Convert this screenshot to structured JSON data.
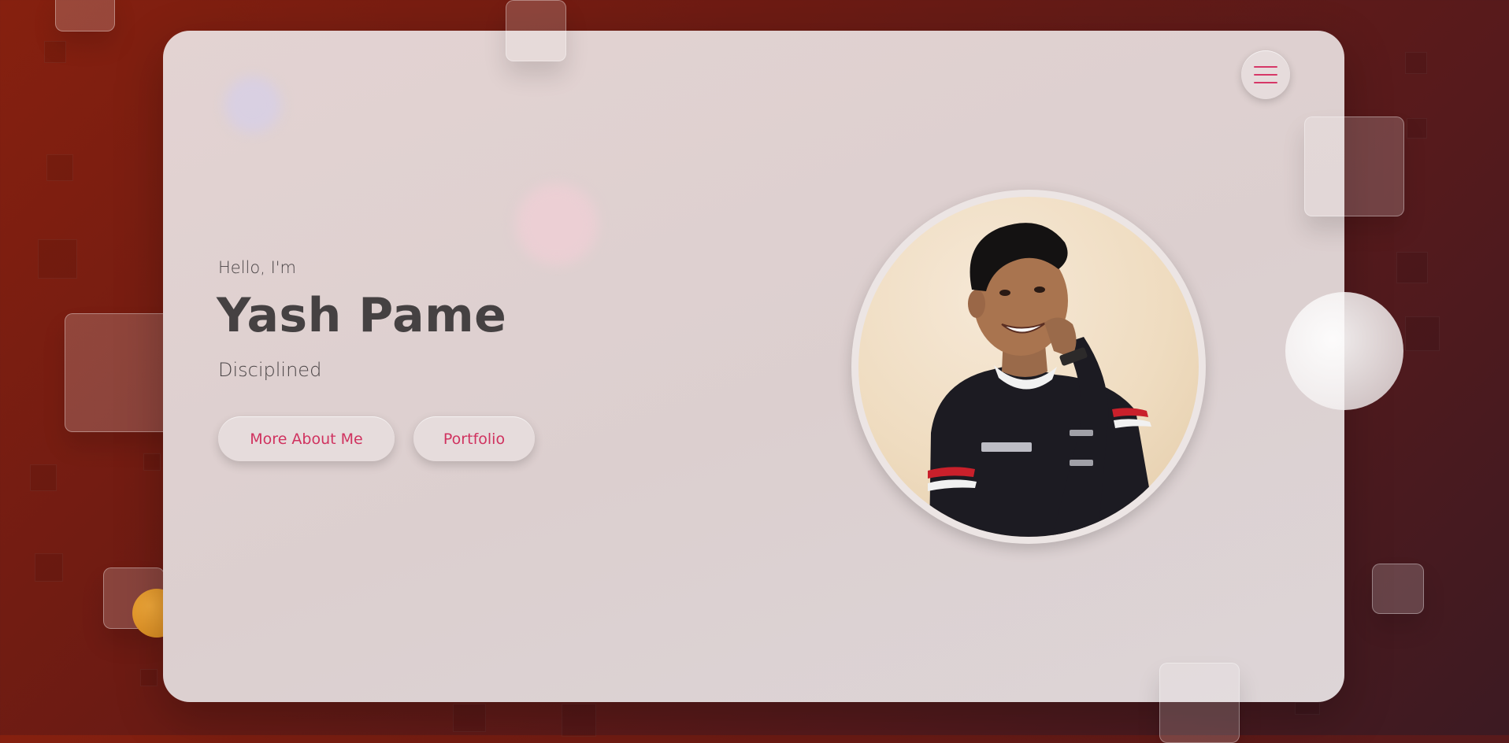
{
  "hero": {
    "greeting": "Hello, I'm",
    "name": "Yash Pame",
    "tagline": "Disciplined"
  },
  "buttons": {
    "about_label": "More About Me",
    "portfolio_label": "Portfolio"
  },
  "menu": {
    "icon": "hamburger-menu-icon"
  },
  "profile_photo": {
    "alt": "Yash Pame"
  },
  "colors": {
    "accent": "#d0325f",
    "heading": "#454142",
    "card": "#e0d3d2",
    "background_start": "#86200f",
    "background_end": "#3c1a22"
  }
}
